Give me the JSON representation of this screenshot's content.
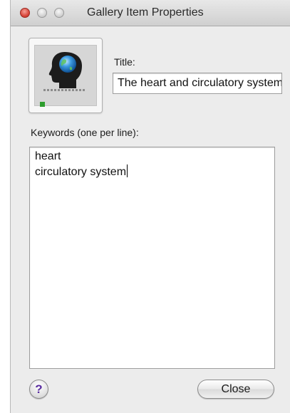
{
  "window": {
    "title": "Gallery Item Properties"
  },
  "thumbnail": {
    "icon": "head-globe-icon",
    "status_color": "#2e9d2e"
  },
  "form": {
    "title_label": "Title:",
    "title_value": "The heart and circulatory system",
    "keywords_label": "Keywords (one per line):",
    "keywords": [
      "heart",
      "circulatory system"
    ]
  },
  "buttons": {
    "help_label": "?",
    "close_label": "Close"
  }
}
